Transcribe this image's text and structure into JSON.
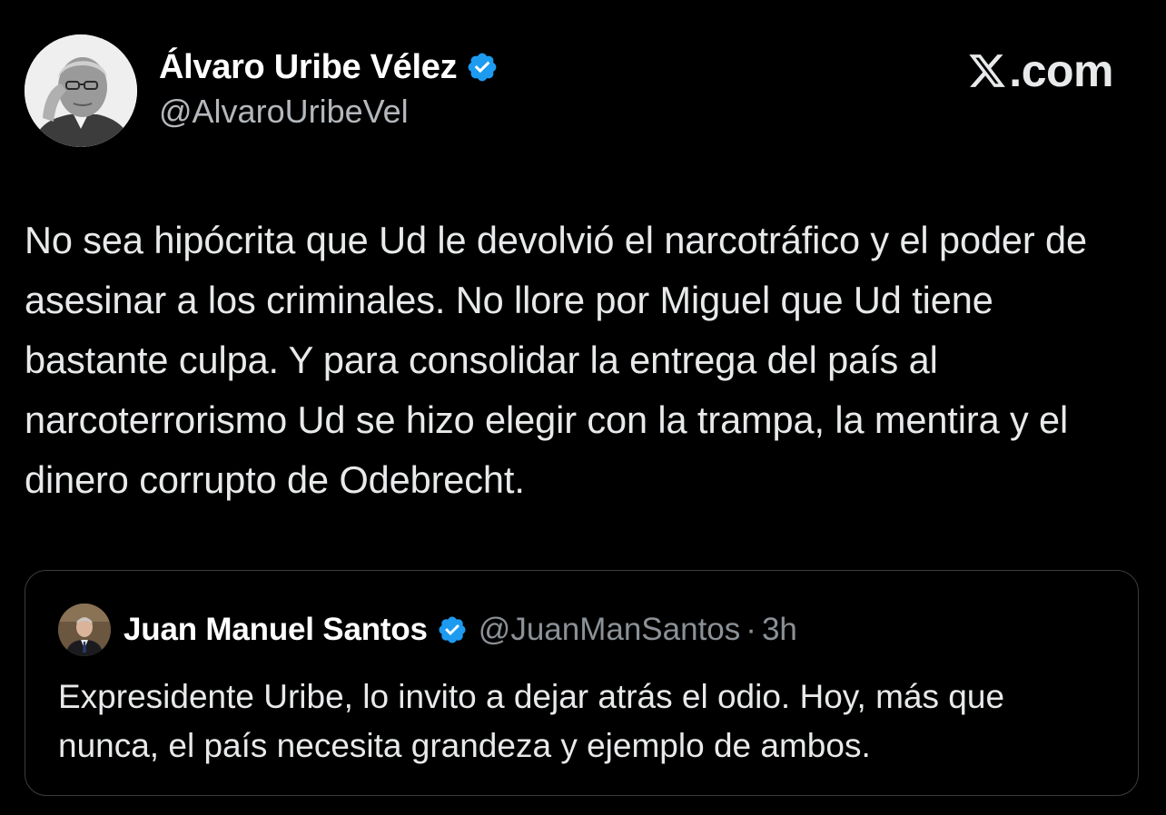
{
  "tweet": {
    "author": {
      "name": "Álvaro Uribe Vélez",
      "handle": "@AlvaroUribeVel",
      "verified": true,
      "avatar": "avatar-photo"
    },
    "text": "No sea hipócrita que Ud le devolvió el narcotráfico y el poder de asesinar a los criminales. No llore por Miguel que Ud tiene bastante culpa. Y para consolidar la entrega del país al narcoterrorismo Ud se hizo elegir con la trampa, la mentira y el dinero corrupto de Odebrecht."
  },
  "brand": {
    "logo_icon": "x-logo-icon",
    "domain": ".com"
  },
  "quoted_tweet": {
    "author": {
      "name": "Juan Manuel Santos",
      "handle": "@JuanManSantos",
      "verified": true,
      "avatar": "avatar-photo"
    },
    "separator": "·",
    "time": "3h",
    "text": "Expresidente Uribe, lo invito a dejar atrás el odio. Hoy, más que nunca, el país necesita grandeza y ejemplo de ambos."
  },
  "colors": {
    "background": "#000000",
    "text_primary": "#e7e9ea",
    "text_secondary": "#8b9196",
    "verified_blue": "#1d9bf0",
    "card_border": "#3a3d41"
  }
}
